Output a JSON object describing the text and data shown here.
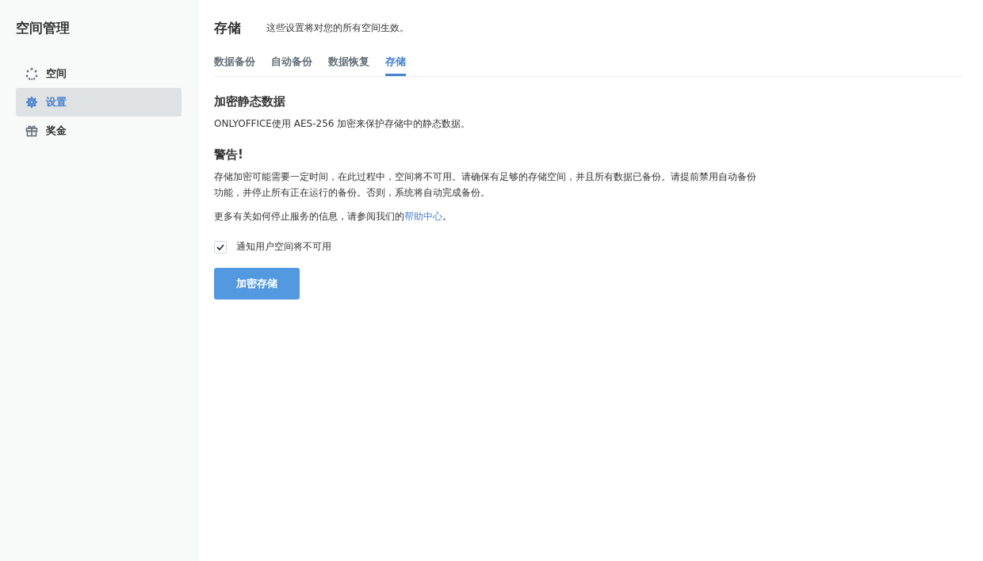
{
  "sidebar": {
    "title": "空间管理",
    "items": [
      {
        "label": "空间",
        "kind": "rooms",
        "selected": false
      },
      {
        "label": "设置",
        "kind": "settings",
        "selected": true
      },
      {
        "label": "奖金",
        "kind": "gift",
        "selected": false
      }
    ]
  },
  "header": {
    "title": "存储",
    "subtitle": "这些设置将对您的所有空间生效。"
  },
  "tabs": [
    {
      "label": "数据备份",
      "selected": false
    },
    {
      "label": "自动备份",
      "selected": false
    },
    {
      "label": "数据恢复",
      "selected": false
    },
    {
      "label": "存储",
      "selected": true
    }
  ],
  "section": {
    "heading": "加密静态数据",
    "description": "ONLYOFFICE使用 AES-256 加密来保护存储中的静态数据。",
    "warning_heading": "警告!",
    "warning_text": "存储加密可能需要一定时间，在此过程中，空间将不可用。请确保有足够的存储空间，并且所有数据已备份。请提前禁用自动备份功能，并停止所有正在运行的备份。否则，系统将自动完成备份。",
    "info_before": "更多有关如何停止服务的信息，请参阅我们的",
    "info_link": "帮助中心",
    "info_after": "。",
    "checkbox": {
      "label": "通知用户空间将不可用",
      "checked": true
    },
    "button": "加密存储"
  }
}
